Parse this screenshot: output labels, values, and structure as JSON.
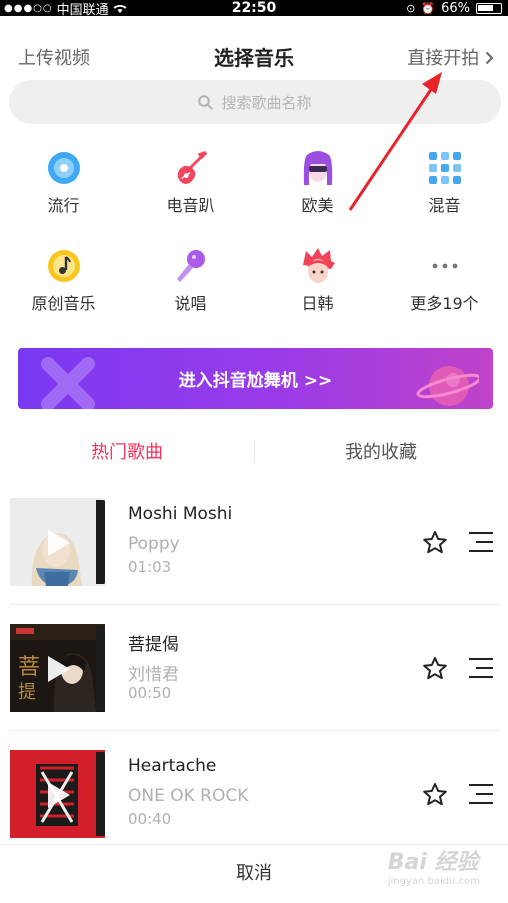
{
  "status_bar": {
    "carrier": "中国联通",
    "time": "22:50",
    "battery": "66%"
  },
  "header": {
    "upload": "上传视频",
    "title": "选择音乐",
    "start": "直接开拍"
  },
  "search": {
    "placeholder": "搜索歌曲名称"
  },
  "categories": [
    {
      "label": "流行",
      "icon": "vinyl-disc-icon",
      "color": "#3fa9f5"
    },
    {
      "label": "电音趴",
      "icon": "electric-guitar-icon",
      "color": "#f5445e"
    },
    {
      "label": "欧美",
      "icon": "face-sunglasses-icon",
      "color": "#9b4fe0"
    },
    {
      "label": "混音",
      "icon": "grid-tiles-icon",
      "color": "#47a6f0"
    },
    {
      "label": "原创音乐",
      "icon": "music-note-circle-icon",
      "color": "#f7c61f"
    },
    {
      "label": "说唱",
      "icon": "microphone-icon",
      "color": "#a85be8"
    },
    {
      "label": "日韩",
      "icon": "anime-face-icon",
      "color": "#f0445a"
    },
    {
      "label": "更多19个",
      "icon": "more-dots-icon",
      "color": "#888888"
    }
  ],
  "banner": {
    "text": "进入抖音尬舞机 >>"
  },
  "tabs": {
    "hot": "热门歌曲",
    "favorites": "我的收藏"
  },
  "songs": [
    {
      "title": "Moshi Moshi",
      "artist": "Poppy",
      "duration": "01:03"
    },
    {
      "title": "菩提偈",
      "artist": "刘惜君",
      "duration": "00:50"
    },
    {
      "title": "Heartache",
      "artist": "ONE OK ROCK",
      "duration": "00:40"
    }
  ],
  "cancel": "取消",
  "watermark": {
    "main": "Bai 经验",
    "sub": "jingyan.baidu.com"
  }
}
